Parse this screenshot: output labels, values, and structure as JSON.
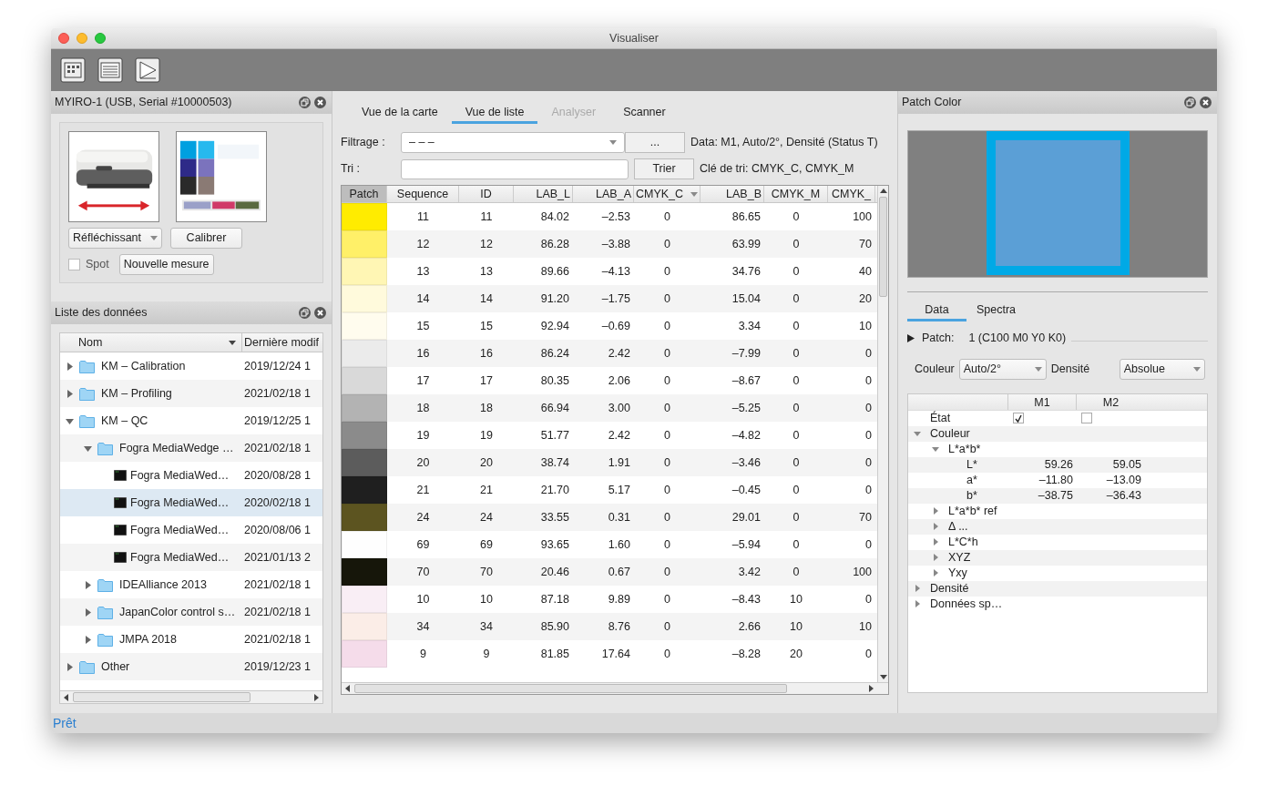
{
  "window": {
    "title": "Visualiser"
  },
  "toolbar": {
    "buttons": [
      {
        "kind": "chart"
      },
      {
        "kind": "list"
      },
      {
        "kind": "triangle"
      }
    ]
  },
  "device_panel": {
    "title": "MYIRO-1 (USB, Serial #10000503)",
    "mode_dropdown": "Réfléchissant",
    "calibrate_button": "Calibrer",
    "spot": {
      "label": "Spot",
      "checked": false
    },
    "new_measure_button": "Nouvelle mesure"
  },
  "data_list": {
    "title": "Liste des données",
    "columns": [
      "Nom",
      "Dernière modif"
    ],
    "items": [
      {
        "name": "KM – Calibration",
        "date": "2019/12/24 1",
        "kind": "folder",
        "expanded": false,
        "selected": false
      },
      {
        "name": "KM – Profiling",
        "date": "2021/02/18 1",
        "kind": "folder",
        "expanded": false,
        "selected": false
      },
      {
        "name": "KM – QC",
        "date": "2019/12/25 1",
        "kind": "folder",
        "expanded": true,
        "selected": false,
        "children": [
          {
            "name": "Fogra MediaWedge …",
            "date": "2021/02/18 1",
            "kind": "folder",
            "expanded": true,
            "selected": false,
            "children": [
              {
                "name": "Fogra MediaWed…",
                "date": "2020/08/28 1",
                "kind": "file",
                "selected": false
              },
              {
                "name": "Fogra MediaWed…",
                "date": "2020/02/18 1",
                "kind": "file",
                "selected": true
              },
              {
                "name": "Fogra MediaWed…",
                "date": "2020/08/06 1",
                "kind": "file",
                "selected": false
              },
              {
                "name": "Fogra MediaWed…",
                "date": "2021/01/13 2",
                "kind": "file",
                "selected": false
              }
            ]
          },
          {
            "name": "IDEAlliance 2013",
            "date": "2021/02/18 1",
            "kind": "folder",
            "expanded": false,
            "selected": false
          },
          {
            "name": "JapanColor control s…",
            "date": "2021/02/18 1",
            "kind": "folder",
            "expanded": false,
            "selected": false
          },
          {
            "name": "JMPA 2018",
            "date": "2021/02/18 1",
            "kind": "folder",
            "expanded": false,
            "selected": false
          }
        ]
      },
      {
        "name": "Other",
        "date": "2019/12/23 1",
        "kind": "folder",
        "expanded": false,
        "selected": false
      }
    ]
  },
  "tabs": [
    {
      "label": "Vue de la carte",
      "selected": false,
      "disabled": false
    },
    {
      "label": "Vue de liste",
      "selected": true,
      "disabled": false
    },
    {
      "label": "Analyser",
      "selected": false,
      "disabled": true
    },
    {
      "label": "Scanner",
      "selected": false,
      "disabled": false
    }
  ],
  "filter": {
    "label": "Filtrage :",
    "value": "– – –",
    "more_button": "...",
    "info": "Data: M1, Auto/2°, Densité (Status T)"
  },
  "sort": {
    "label": "Tri :",
    "button": "Trier",
    "info": "Clé de tri: CMYK_C, CMYK_M"
  },
  "table": {
    "patch_column": "Patch",
    "columns": [
      "Sequence",
      "ID",
      "LAB_L",
      "LAB_A",
      "CMYK_C",
      "LAB_B",
      "CMYK_M",
      "CMYK_"
    ],
    "rows": [
      {
        "color": "#ffec00",
        "cells": [
          "11",
          "11",
          "84.02",
          "–2.53",
          "0",
          "86.65",
          "0",
          "100"
        ]
      },
      {
        "color": "#fff068",
        "cells": [
          "12",
          "12",
          "86.28",
          "–3.88",
          "0",
          "63.99",
          "0",
          "70"
        ]
      },
      {
        "color": "#fff6b4",
        "cells": [
          "13",
          "13",
          "89.66",
          "–4.13",
          "0",
          "34.76",
          "0",
          "40"
        ]
      },
      {
        "color": "#fffadc",
        "cells": [
          "14",
          "14",
          "91.20",
          "–1.75",
          "0",
          "15.04",
          "0",
          "20"
        ]
      },
      {
        "color": "#fffcee",
        "cells": [
          "15",
          "15",
          "92.94",
          "–0.69",
          "0",
          "3.34",
          "0",
          "10"
        ]
      },
      {
        "color": "#ebebeb",
        "cells": [
          "16",
          "16",
          "86.24",
          "2.42",
          "0",
          "–7.99",
          "0",
          "0"
        ]
      },
      {
        "color": "#d9d9d9",
        "cells": [
          "17",
          "17",
          "80.35",
          "2.06",
          "0",
          "–8.67",
          "0",
          "0"
        ]
      },
      {
        "color": "#b3b3b3",
        "cells": [
          "18",
          "18",
          "66.94",
          "3.00",
          "0",
          "–5.25",
          "0",
          "0"
        ]
      },
      {
        "color": "#8b8b8b",
        "cells": [
          "19",
          "19",
          "51.77",
          "2.42",
          "0",
          "–4.82",
          "0",
          "0"
        ]
      },
      {
        "color": "#5c5c5c",
        "cells": [
          "20",
          "20",
          "38.74",
          "1.91",
          "0",
          "–3.46",
          "0",
          "0"
        ]
      },
      {
        "color": "#1f1f1f",
        "cells": [
          "21",
          "21",
          "21.70",
          "5.17",
          "0",
          "–0.45",
          "0",
          "0"
        ]
      },
      {
        "color": "#5c5420",
        "cells": [
          "24",
          "24",
          "33.55",
          "0.31",
          "0",
          "29.01",
          "0",
          "70"
        ]
      },
      {
        "color": "#fefefe",
        "cells": [
          "69",
          "69",
          "93.65",
          "1.60",
          "0",
          "–5.94",
          "0",
          "0"
        ]
      },
      {
        "color": "#16160a",
        "cells": [
          "70",
          "70",
          "20.46",
          "0.67",
          "0",
          "3.42",
          "0",
          "100"
        ]
      },
      {
        "color": "#f9eef5",
        "cells": [
          "10",
          "10",
          "87.18",
          "9.89",
          "0",
          "–8.43",
          "10",
          "0"
        ]
      },
      {
        "color": "#fbede7",
        "cells": [
          "34",
          "34",
          "85.90",
          "8.76",
          "0",
          "2.66",
          "10",
          "10"
        ]
      },
      {
        "color": "#f5dcea",
        "cells": [
          "9",
          "9",
          "81.85",
          "17.64",
          "0",
          "–8.28",
          "20",
          "0"
        ]
      }
    ]
  },
  "patch_panel": {
    "title": "Patch Color",
    "tabs": [
      {
        "label": "Data",
        "selected": true
      },
      {
        "label": "Spectra",
        "selected": false
      }
    ],
    "patch_label": "Patch:",
    "patch_value": "1 (C100 M0 Y0 K0)",
    "color_label": "Couleur",
    "color_value": "Auto/2°",
    "density_label": "Densité",
    "density_value": "Absolue",
    "columns": [
      "M1",
      "M2"
    ],
    "tree": [
      {
        "name": "État",
        "kind": "check",
        "m1_checked": true,
        "m2_checked": false
      },
      {
        "name": "Couleur",
        "kind": "group",
        "expanded": true,
        "children": [
          {
            "name": "L*a*b*",
            "kind": "group",
            "expanded": true,
            "children": [
              {
                "name": "L*",
                "kind": "value",
                "m1": "59.26",
                "m2": "59.05"
              },
              {
                "name": "a*",
                "kind": "value",
                "m1": "–11.80",
                "m2": "–13.09"
              },
              {
                "name": "b*",
                "kind": "value",
                "m1": "–38.75",
                "m2": "–36.43"
              }
            ]
          },
          {
            "name": "L*a*b* ref",
            "kind": "group",
            "expanded": false
          },
          {
            "name": "Δ ...",
            "kind": "group",
            "expanded": false
          },
          {
            "name": "L*C*h",
            "kind": "group",
            "expanded": false
          },
          {
            "name": "XYZ",
            "kind": "group",
            "expanded": false
          },
          {
            "name": "Yxy",
            "kind": "group",
            "expanded": false
          }
        ]
      },
      {
        "name": "Densité",
        "kind": "group",
        "expanded": false
      },
      {
        "name": "Données sp…",
        "kind": "group",
        "expanded": false
      }
    ]
  },
  "status_bar": "Prêt"
}
